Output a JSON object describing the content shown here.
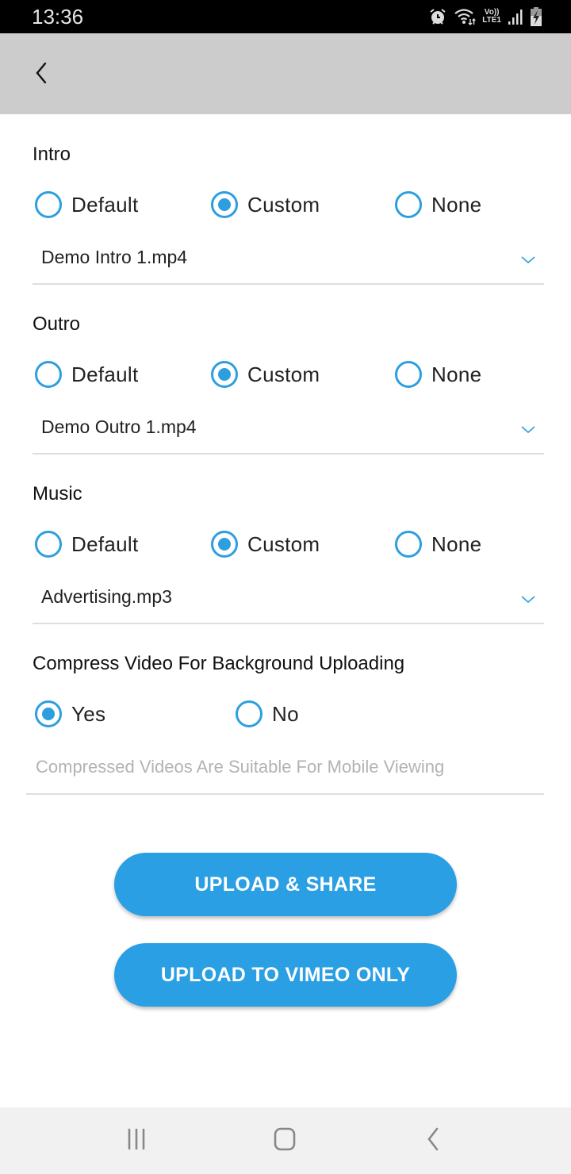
{
  "status_bar": {
    "time": "13:36",
    "icons": [
      "alarm-icon",
      "wifi-icon",
      "volte-lte-icon",
      "signal-icon",
      "battery-charging-icon"
    ],
    "volte_label": "Vo))",
    "lte_label": "LTE1"
  },
  "app_bar": {
    "back_icon": "chevron-left-icon"
  },
  "sections": [
    {
      "title": "Intro",
      "options": [
        "Default",
        "Custom",
        "None"
      ],
      "selected": "Custom",
      "dropdown_value": "Demo Intro 1.mp4"
    },
    {
      "title": "Outro",
      "options": [
        "Default",
        "Custom",
        "None"
      ],
      "selected": "Custom",
      "dropdown_value": "Demo Outro 1.mp4"
    },
    {
      "title": "Music",
      "options": [
        "Default",
        "Custom",
        "None"
      ],
      "selected": "Custom",
      "dropdown_value": "Advertising.mp3"
    }
  ],
  "compress": {
    "title": "Compress Video For Background Uploading",
    "options": [
      "Yes",
      "No"
    ],
    "selected": "Yes",
    "helper_text": "Compressed Videos Are Suitable For Mobile Viewing"
  },
  "buttons": {
    "upload_share": "UPLOAD & SHARE",
    "upload_vimeo": "UPLOAD TO VIMEO ONLY"
  },
  "nav_bar": {
    "icons": [
      "recent-apps-icon",
      "home-icon",
      "back-icon"
    ]
  },
  "colors": {
    "accent": "#2d9fdf",
    "button": "#2a9fe4",
    "app_bar": "#cccccc"
  }
}
